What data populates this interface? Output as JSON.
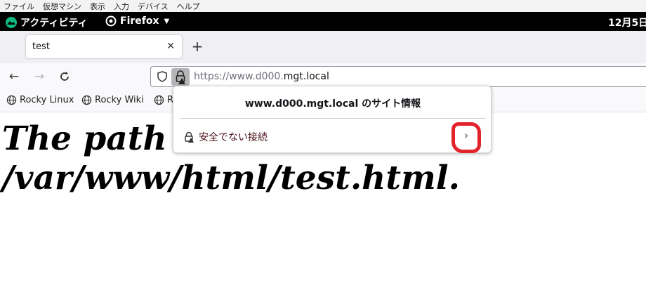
{
  "vm_menu": [
    "ファイル",
    "仮想マシン",
    "表示",
    "入力",
    "デバイス",
    "ヘルプ"
  ],
  "gnome": {
    "activities_label": "アクティビティ",
    "app_label": "Firefox",
    "clock": "12月5日"
  },
  "tab": {
    "title": "test"
  },
  "url": {
    "prefix": "https://www.d000.",
    "domain": "mgt.local"
  },
  "bookmarks": [
    "Rocky Linux",
    "Rocky Wiki",
    "R"
  ],
  "page": {
    "line1": "The path ",
    "line2": "/var/www/html/test.html."
  },
  "popup": {
    "title": "www.d000.mgt.local のサイト情報",
    "connection_label": "安全でない接続"
  },
  "colors": {
    "insecure_text": "#4a0f19",
    "annotation": "#e2232a"
  }
}
